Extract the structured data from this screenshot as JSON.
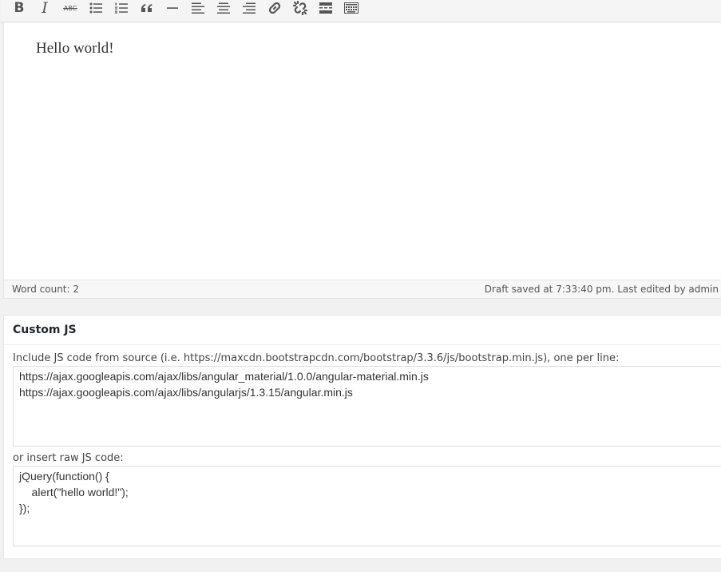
{
  "toolbar": {
    "buttons": [
      {
        "name": "bold-icon",
        "label": "B"
      },
      {
        "name": "italic-icon",
        "label": "I"
      },
      {
        "name": "strikethrough-icon",
        "label": "ABC"
      },
      {
        "name": "bulleted-list-icon"
      },
      {
        "name": "numbered-list-icon"
      },
      {
        "name": "blockquote-icon"
      },
      {
        "name": "horizontal-line-icon"
      },
      {
        "name": "align-left-icon"
      },
      {
        "name": "align-center-icon"
      },
      {
        "name": "align-right-icon"
      },
      {
        "name": "insert-link-icon"
      },
      {
        "name": "remove-link-icon"
      },
      {
        "name": "read-more-icon"
      },
      {
        "name": "toolbar-toggle-icon"
      }
    ]
  },
  "editor": {
    "content": "Hello world!",
    "word_count": "Word count: 2",
    "draft_status": "Draft saved at 7:33:40 pm. Last edited by admin"
  },
  "custom_js": {
    "title": "Custom JS",
    "source_label": "Include JS code from source (i.e. https://maxcdn.bootstrapcdn.com/bootstrap/3.3.6/js/bootstrap.min.js), one per line:",
    "source_value": "https://ajax.googleapis.com/ajax/libs/angular_material/1.0.0/angular-material.min.js\nhttps://ajax.googleapis.com/ajax/libs/angularjs/1.3.15/angular.min.js",
    "raw_label": "or insert raw JS code:",
    "raw_value": "jQuery(function() {\n    alert(\"hello world!\");\n});"
  }
}
